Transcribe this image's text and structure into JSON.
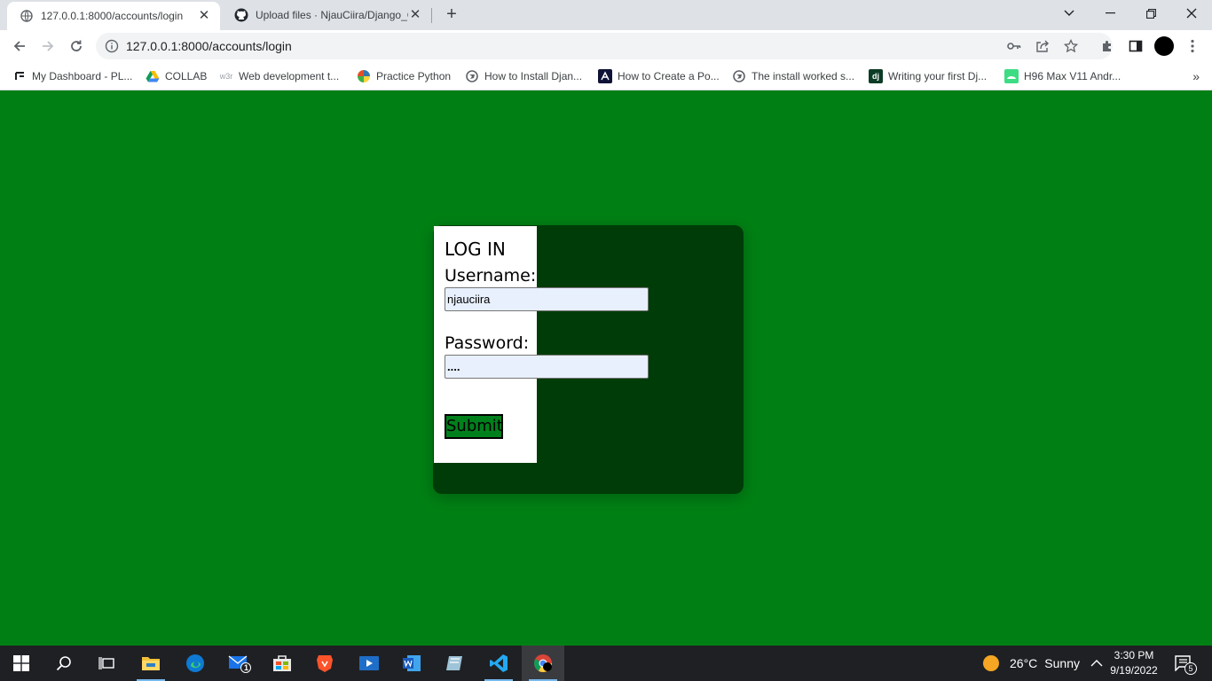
{
  "browser": {
    "tabs": [
      {
        "title": "127.0.0.1:8000/accounts/login",
        "icon": "globe-icon",
        "active": true
      },
      {
        "title": "Upload files · NjauCiira/Django_C",
        "icon": "github-icon",
        "active": false
      }
    ],
    "address": "127.0.0.1:8000/accounts/login"
  },
  "bookmarks": [
    {
      "label": "My Dashboard - PL...",
      "icon": "dashboard-icon"
    },
    {
      "label": "COLLAB",
      "icon": "google-drive-icon"
    },
    {
      "label": "Web development t...",
      "icon": "w3r-icon",
      "icon_text": "w3r"
    },
    {
      "label": "Practice Python",
      "icon": "python-icon"
    },
    {
      "label": "How to Install Djan...",
      "icon": "globe-icon"
    },
    {
      "label": "How to Create a Po...",
      "icon": "lambda-icon"
    },
    {
      "label": "The install worked s...",
      "icon": "globe-icon"
    },
    {
      "label": "Writing your first Dj...",
      "icon": "django-icon",
      "icon_text": "dj"
    },
    {
      "label": "H96 Max V11 Andr...",
      "icon": "android-icon"
    }
  ],
  "login": {
    "heading": "LOG IN",
    "username_label": "Username:",
    "username_value": "njauciira",
    "password_label": "Password:",
    "password_value": "....",
    "submit_label": "Submit"
  },
  "colors": {
    "page_background": "#008014",
    "card_background": "#003c08",
    "submit_background": "#00801c"
  },
  "taskbar": {
    "weather_temp": "26°C",
    "weather_text": "Sunny",
    "time": "3:30 PM",
    "date": "9/19/2022",
    "mail_badge": "1",
    "notification_badge": "5"
  }
}
